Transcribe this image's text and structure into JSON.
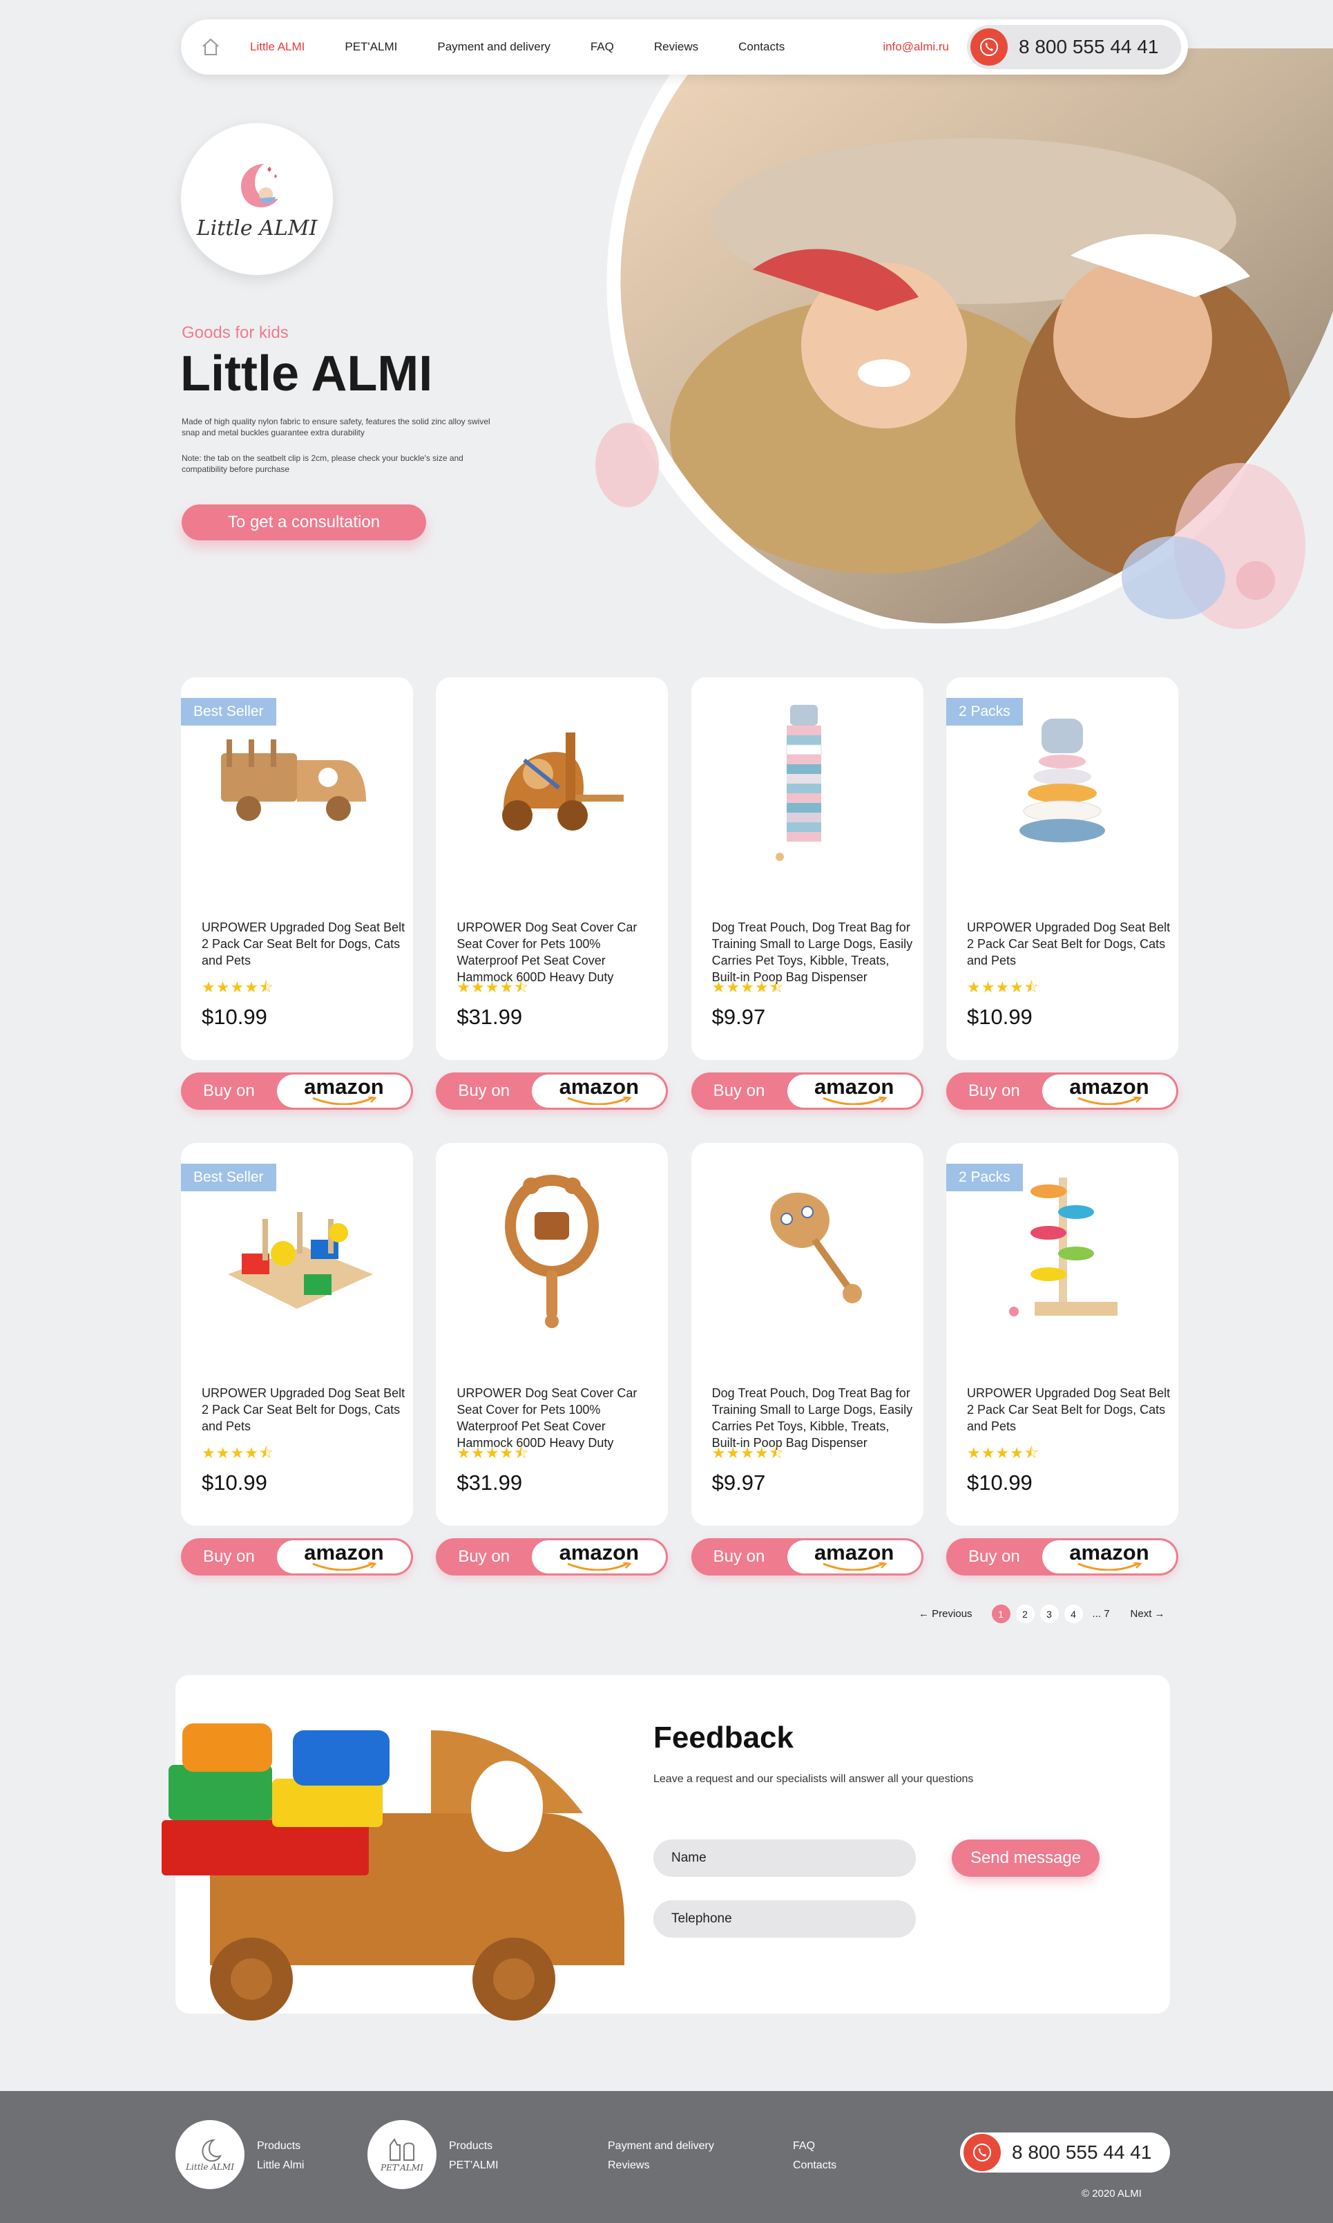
{
  "nav": {
    "links": [
      "Little ALMI",
      "PET'ALMI",
      "Payment and delivery",
      "FAQ",
      "Reviews",
      "Contacts"
    ],
    "email": "info@almi.ru",
    "phone": "8 800 555 44 41"
  },
  "hero": {
    "logo_text": "Little ALMI",
    "subtitle": "Goods for kids",
    "title": "Little ALMI",
    "description": "Made of high quality nylon fabric to ensure safety, features the solid zinc alloy swivel snap and metal buckles guarantee extra durability",
    "note": "Note: the tab on the seatbelt clip is 2cm, please check your buckle's size and compatibility before purchase",
    "cta": "To get a consultation"
  },
  "products": [
    {
      "badge": "Best Seller",
      "title": "URPOWER Upgraded Dog Seat Belt 2 Pack Car Seat Belt for Dogs, Cats and Pets",
      "stars": "★★★★⯪",
      "price": "$10.99",
      "buy": "Buy on",
      "store": "amazon",
      "image": "wooden-truck"
    },
    {
      "badge": "",
      "title": "URPOWER Dog Seat Cover Car Seat Cover for Pets 100% Waterproof Pet Seat Cover Hammock 600D Heavy Duty",
      "stars": "★★★★⯪",
      "price": "$31.99",
      "buy": "Buy on",
      "store": "amazon",
      "image": "wooden-forklift"
    },
    {
      "badge": "",
      "title": "Dog Treat Pouch, Dog Treat Bag for Training Small to Large Dogs, Easily Carries Pet Toys, Kibble, Treats, Built-in Poop Bag Dispenser",
      "stars": "★★★★⯪",
      "price": "$9.97",
      "buy": "Buy on",
      "store": "amazon",
      "image": "block-tower"
    },
    {
      "badge": "2 Packs",
      "title": "URPOWER Upgraded Dog Seat Belt 2 Pack Car Seat Belt for Dogs, Cats and Pets",
      "stars": "★★★★⯪",
      "price": "$10.99",
      "buy": "Buy on",
      "store": "amazon",
      "image": "ring-stacker"
    },
    {
      "badge": "Best Seller",
      "title": "URPOWER Upgraded Dog Seat Belt 2 Pack Car Seat Belt for Dogs, Cats and Pets",
      "stars": "★★★★⯪",
      "price": "$10.99",
      "buy": "Buy on",
      "store": "amazon",
      "image": "shape-sorter"
    },
    {
      "badge": "",
      "title": "URPOWER Dog Seat Cover Car Seat Cover for Pets 100% Waterproof Pet Seat Cover Hammock 600D Heavy Duty",
      "stars": "★★★★⯪",
      "price": "$31.99",
      "buy": "Buy on",
      "store": "amazon",
      "image": "bear-rattle"
    },
    {
      "badge": "",
      "title": "Dog Treat Pouch, Dog Treat Bag for Training Small to Large Dogs, Easily Carries Pet Toys, Kibble, Treats, Built-in Poop Bag Dispenser",
      "stars": "★★★★⯪",
      "price": "$9.97",
      "buy": "Buy on",
      "store": "amazon",
      "image": "paw-rattle"
    },
    {
      "badge": "2 Packs",
      "title": "URPOWER Upgraded Dog Seat Belt 2 Pack Car Seat Belt for Dogs, Cats and Pets",
      "stars": "★★★★⯪",
      "price": "$10.99",
      "buy": "Buy on",
      "store": "amazon",
      "image": "marble-tree"
    }
  ],
  "pagination": {
    "prev": "Previous",
    "pages": [
      "1",
      "2",
      "3",
      "4"
    ],
    "ellipsis": "... 7",
    "next": "Next",
    "current": "1"
  },
  "feedback": {
    "title": "Feedback",
    "subtitle": "Leave a request and our specialists will answer all your questions",
    "name_placeholder": "Name",
    "phone_placeholder": "Telephone",
    "send": "Send message"
  },
  "footer": {
    "logo1_text": "Little ALMI",
    "logo2_text": "PET'ALMI",
    "col1": [
      "Products",
      "Little Almi"
    ],
    "col2": [
      "Products",
      "PET'ALMI"
    ],
    "col3": [
      "Payment and delivery",
      "Reviews"
    ],
    "col4": [
      "FAQ",
      "Contacts"
    ],
    "phone": "8 800 555 44 41",
    "copyright": "© 2020 ALMI"
  },
  "colors": {
    "accent_pink": "#ef7b8e",
    "accent_red": "#e83a3a",
    "badge_blue": "#9fc1e8",
    "footer_gray": "#6f7074"
  }
}
